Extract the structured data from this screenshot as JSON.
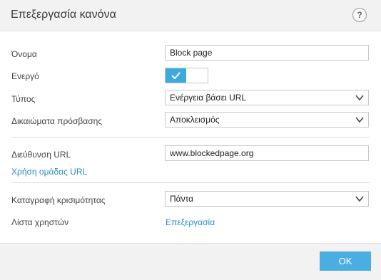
{
  "dialog": {
    "title": "Επεξεργασία κανόνα",
    "help_icon": "question-circle-icon",
    "help_glyph": "?"
  },
  "form": {
    "name_label": "Όνομα",
    "name_value": "Block page",
    "active_label": "Ενεργό",
    "active_value": true,
    "type_label": "Τύπος",
    "type_value": "Ενέργεια βάσει URL",
    "access_label": "Δικαιώματα πρόσβασης",
    "access_value": "Αποκλεισμός",
    "url_label": "Διεύθυνση URL",
    "url_value": "www.blockedpage.org",
    "url_group_link": "Χρήση ομάδας URL",
    "severity_label": "Καταγραφή κρισιμότητας",
    "severity_value": "Πάντα",
    "users_label": "Λίστα χρηστών",
    "users_edit_link": "Επεξεργασία"
  },
  "footer": {
    "ok_label": "OK"
  },
  "colors": {
    "accent": "#3ea9dc",
    "link": "#2a8bc4",
    "ok_button": "#4aaee0"
  }
}
